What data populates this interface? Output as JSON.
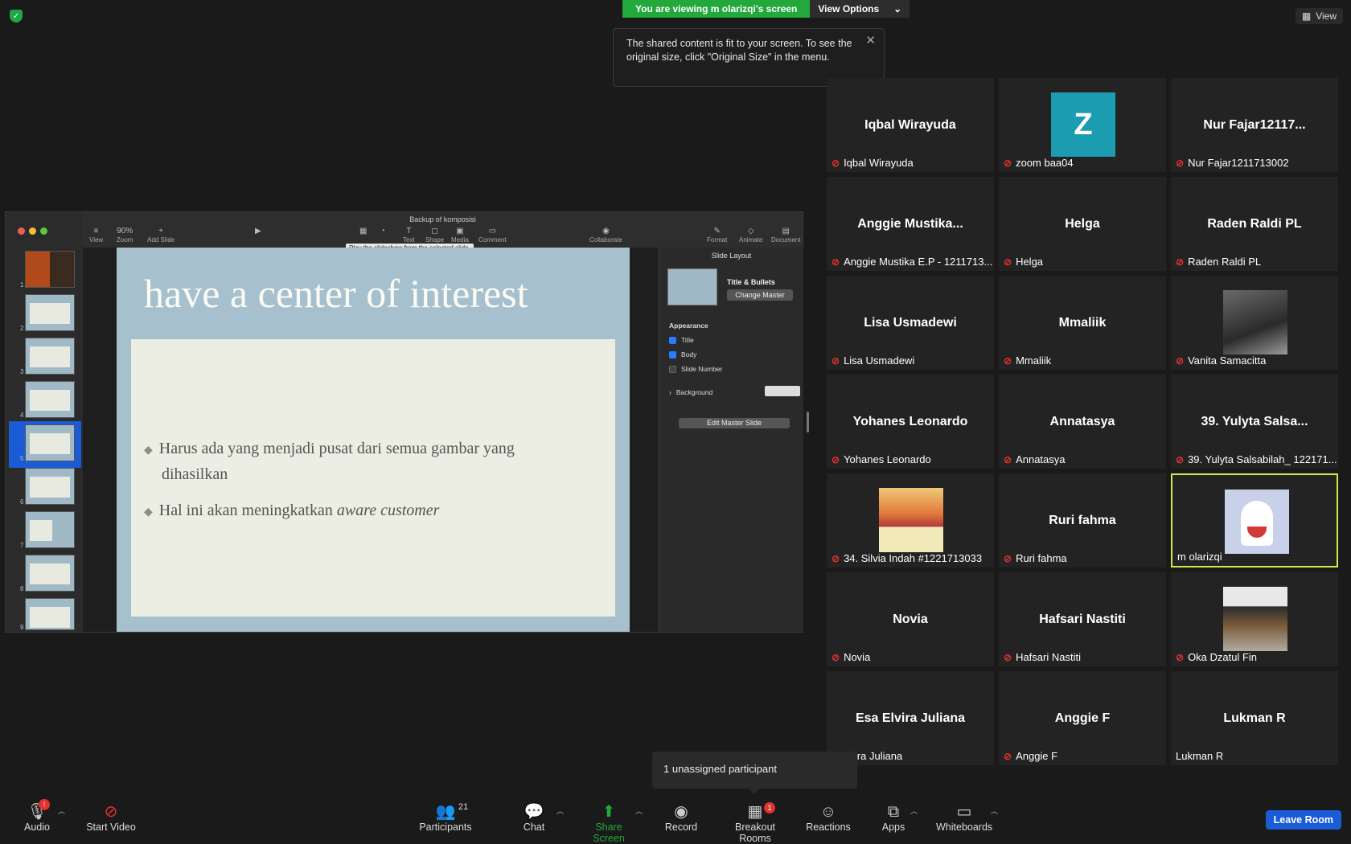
{
  "top": {
    "viewing_text": "You are viewing m olarizqi's screen",
    "view_options": "View Options",
    "view_button": "View",
    "notice": "The shared content is fit to your screen. To see the original size, click \"Original Size\" in the menu."
  },
  "keynote": {
    "doc_title": "Backup of komposisi",
    "zoom": "90%",
    "toolbar": [
      {
        "label": "View",
        "icon": "≡"
      },
      {
        "label": "Zoom",
        "icon": "90%"
      },
      {
        "label": "Add Slide",
        "icon": "+"
      },
      {
        "label": "Table",
        "icon": "▦"
      },
      {
        "label": "Chart",
        "icon": "◔"
      },
      {
        "label": "Text",
        "icon": "T"
      },
      {
        "label": "Shape",
        "icon": "◻"
      },
      {
        "label": "Media",
        "icon": "▣"
      },
      {
        "label": "Comment",
        "icon": "▭"
      },
      {
        "label": "Collaborate",
        "icon": "◉"
      },
      {
        "label": "Format",
        "icon": "✎"
      },
      {
        "label": "Animate",
        "icon": "◇"
      },
      {
        "label": "Document",
        "icon": "▤"
      }
    ],
    "play_tooltip": "Play the slideshow from the selected slide.",
    "slide_numbers": [
      "1",
      "2",
      "3",
      "4",
      "5",
      "6",
      "7",
      "8",
      "9"
    ],
    "slide": {
      "title": "have a center of interest",
      "bullet1_line1": "Harus ada yang menjadi pusat dari semua gambar yang",
      "bullet1_line2": "dihasilkan",
      "bullet2_plain": "Hal ini akan meningkatkan ",
      "bullet2_italic": "aware customer"
    },
    "inspector": {
      "title": "Slide Layout",
      "layout_name": "Title & Bullets",
      "change_master": "Change Master",
      "appearance": "Appearance",
      "title_cb": "Title",
      "body_cb": "Body",
      "slide_number_cb": "Slide Number",
      "background": "Background",
      "edit_master": "Edit Master Slide"
    }
  },
  "participants": [
    {
      "name": "Iqbal Wirayuda",
      "label": "Iqbal Wirayuda",
      "muted": true
    },
    {
      "name": "",
      "label": "zoom baa04",
      "muted": true,
      "avatar": "Z"
    },
    {
      "name": "Nur Fajar12117...",
      "label": "Nur Fajar1211713002",
      "muted": true
    },
    {
      "name": "Anggie  Mustika...",
      "label": "Anggie Mustika E.P - 1211713...",
      "muted": true
    },
    {
      "name": "Helga",
      "label": "Helga",
      "muted": true
    },
    {
      "name": "Raden Raldi PL",
      "label": "Raden Raldi PL",
      "muted": true
    },
    {
      "name": "Lisa Usmadewi",
      "label": "Lisa Usmadewi",
      "muted": true
    },
    {
      "name": "Mmaliik",
      "label": "Mmaliik",
      "muted": true
    },
    {
      "name": "",
      "label": "Vanita Samacitta",
      "muted": true,
      "photo": "bw-portrait"
    },
    {
      "name": "Yohanes Leonardo",
      "label": "Yohanes Leonardo",
      "muted": true
    },
    {
      "name": "Annatasya",
      "label": "Annatasya",
      "muted": true
    },
    {
      "name": "39. Yulyta Salsa...",
      "label": "39. Yulyta Salsabilah_ 122171...",
      "muted": true
    },
    {
      "name": "",
      "label": "34. Silvia Indah #1221713033",
      "muted": true,
      "photo": "fruit-basket"
    },
    {
      "name": "Ruri fahma",
      "label": "Ruri fahma",
      "muted": true
    },
    {
      "name": "",
      "label": "m olarizqi",
      "muted": false,
      "photo": "cartoon-face",
      "active": true
    },
    {
      "name": "Novia",
      "label": "Novia",
      "muted": true
    },
    {
      "name": "Hafsari Nastiti",
      "label": "Hafsari Nastiti",
      "muted": true
    },
    {
      "name": "",
      "label": "Oka Dzatul Fin",
      "muted": true,
      "photo": "man-photo"
    },
    {
      "name": "Esa Elvira Juliana",
      "label": "a Elvira Juliana",
      "muted": false
    },
    {
      "name": "Anggie F",
      "label": "Anggie F",
      "muted": true
    },
    {
      "name": "Lukman R",
      "label": "Lukman R",
      "muted": false
    }
  ],
  "unassigned": "1 unassigned participant",
  "bottom": {
    "audio": "Audio",
    "start_video": "Start Video",
    "participants": "Participants",
    "participants_count": "21",
    "chat": "Chat",
    "share_screen": "Share Screen",
    "record": "Record",
    "breakout": "Breakout Rooms",
    "breakout_badge": "1",
    "reactions": "Reactions",
    "apps": "Apps",
    "whiteboards": "Whiteboards",
    "leave_room": "Leave Room",
    "audio_badge": "!"
  },
  "colors": {
    "green": "#23a83c",
    "blue": "#1a5bd6",
    "mute_red": "#e0322f",
    "active_border": "#d4e84b"
  }
}
